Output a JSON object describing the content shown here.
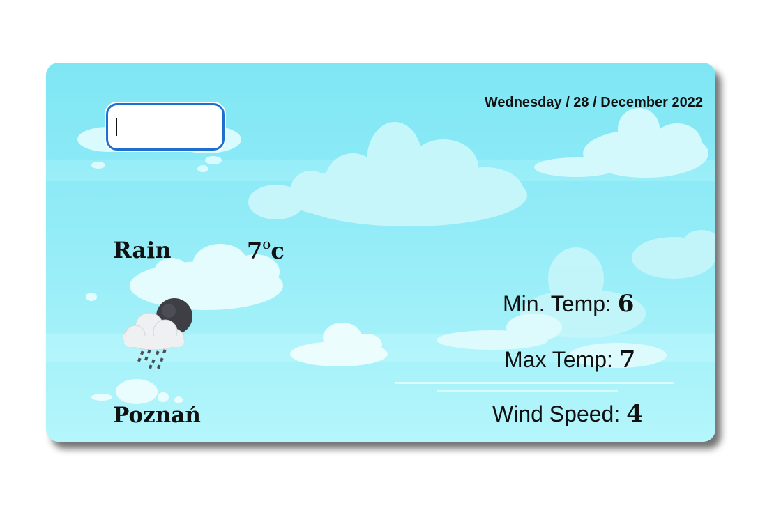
{
  "search": {
    "value": "",
    "placeholder": ""
  },
  "header": {
    "date": "Wednesday / 28 / December 2022"
  },
  "current": {
    "condition": "Rain",
    "temp_value": "7",
    "temp_unit_deg": "o",
    "temp_unit": "c",
    "icon": "rain-cloud-moon-icon",
    "city": "Poznań"
  },
  "stats": {
    "min_label": "Min. Temp: ",
    "min_value": "6",
    "max_label": "Max Temp: ",
    "max_value": "7",
    "wind_label": "Wind Speed: ",
    "wind_value": "4"
  },
  "colors": {
    "sky_top": "#7fe6f4",
    "sky_bottom": "#b4f6fb",
    "input_border": "#1f6fd1",
    "text": "#111111"
  }
}
